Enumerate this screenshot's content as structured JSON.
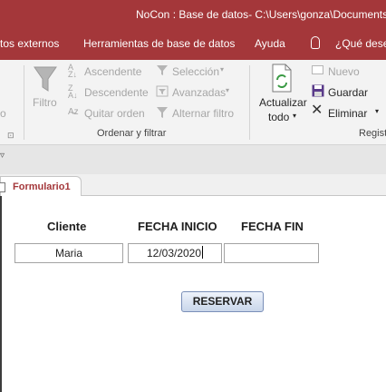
{
  "window": {
    "title": "NoCon : Base de datos- C:\\Users\\gonza\\Documents\\"
  },
  "menu": {
    "items": [
      "tos externos",
      "Herramientas de base de datos",
      "Ayuda",
      "¿Qué dese"
    ]
  },
  "ribbon": {
    "sort_filter": {
      "filter_label": "Filtro",
      "ascending_label": "Ascendente",
      "descending_label": "Descendente",
      "remove_sort_label": "Quitar orden",
      "selection_label": "Selección",
      "advanced_label": "Avanzadas",
      "toggle_filter_label": "Alternar filtro",
      "group_label": "Ordenar y filtrar"
    },
    "records": {
      "refresh_label_line1": "Actualizar",
      "refresh_label_line2": "todo",
      "new_label": "Nuevo",
      "save_label": "Guardar",
      "delete_label": "Eliminar",
      "group_label": "Regist"
    },
    "left_clip_label": "o"
  },
  "tab": {
    "label": "Formulario1"
  },
  "form": {
    "headers": {
      "client": "Cliente",
      "start_date": "FECHA INICIO",
      "end_date": "FECHA FIN"
    },
    "values": {
      "client": "Maria",
      "start_date": "12/03/2020",
      "end_date": ""
    },
    "reserve_button": "RESERVAR"
  },
  "colors": {
    "accent": "#a4373a",
    "ribbon_bg": "#f3f3f3",
    "button_border": "#7a8fb8"
  }
}
